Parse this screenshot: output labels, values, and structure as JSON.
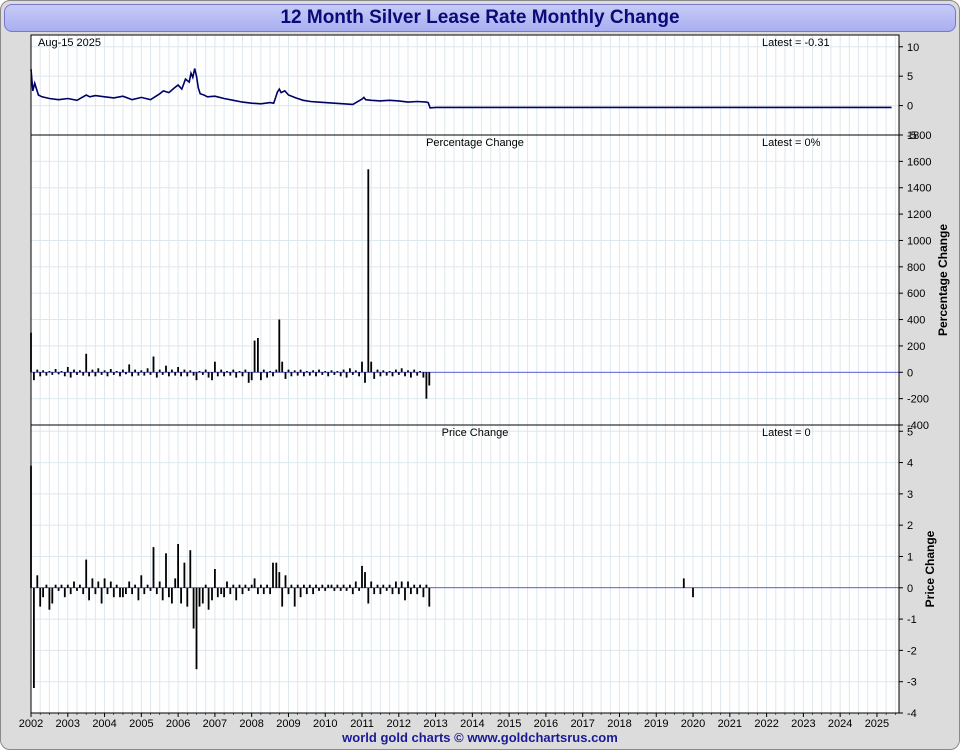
{
  "title": "12 Month Silver Lease Rate Monthly Change",
  "footer": "world gold charts © www.goldchartsrus.com",
  "colors": {
    "title_text": "#0a0a78",
    "title_bg": "#b8bcf4",
    "line": "#000066",
    "zero_line": "#3333cc",
    "bars": "#000000",
    "grid": "#dde8ee",
    "footer_text": "#1a1a99"
  },
  "x_axis": {
    "labels": [
      "2002",
      "2003",
      "2004",
      "2005",
      "2006",
      "2007",
      "2008",
      "2009",
      "2010",
      "2011",
      "2012",
      "2013",
      "2014",
      "2015",
      "2016",
      "2017",
      "2018",
      "2019",
      "2020",
      "2021",
      "2022",
      "2023",
      "2024",
      "2025"
    ],
    "range": [
      2002,
      2025.6
    ]
  },
  "chart_data": [
    {
      "type": "line",
      "name": "lease-rate",
      "date_label": "Aug-15  2025",
      "latest_label": "Latest = -0.31",
      "ylim": [
        -5,
        12
      ],
      "yticks": [
        "10",
        "5",
        "0",
        "-5"
      ],
      "ytick_values": [
        10,
        5,
        0,
        -5
      ],
      "x": [
        2002.0,
        2002.05,
        2002.1,
        2002.2,
        2002.3,
        2002.5,
        2002.75,
        2003.0,
        2003.25,
        2003.5,
        2003.6,
        2003.75,
        2004.0,
        2004.25,
        2004.5,
        2004.75,
        2005.0,
        2005.25,
        2005.5,
        2005.6,
        2005.75,
        2005.9,
        2006.0,
        2006.1,
        2006.2,
        2006.3,
        2006.35,
        2006.4,
        2006.45,
        2006.5,
        2006.55,
        2006.6,
        2006.7,
        2006.8,
        2007.0,
        2007.25,
        2007.5,
        2007.75,
        2008.0,
        2008.25,
        2008.5,
        2008.6,
        2008.7,
        2008.75,
        2008.8,
        2008.9,
        2009.0,
        2009.2,
        2009.4,
        2009.6,
        2009.8,
        2010.0,
        2010.25,
        2010.5,
        2010.75,
        2011.0,
        2011.05,
        2011.1,
        2011.25,
        2011.5,
        2011.75,
        2012.0,
        2012.25,
        2012.5,
        2012.75,
        2012.8,
        2012.85,
        2013.0,
        2014.0,
        2016.0,
        2018.0,
        2020.0,
        2022.0,
        2024.0,
        2025.4
      ],
      "y": [
        6.2,
        2.5,
        3.8,
        1.8,
        1.5,
        1.2,
        1.0,
        1.2,
        0.9,
        1.8,
        1.5,
        1.7,
        1.5,
        1.3,
        1.6,
        1.0,
        1.4,
        1.0,
        2.0,
        2.5,
        2.2,
        3.0,
        3.5,
        2.8,
        4.5,
        4.0,
        5.5,
        4.8,
        6.3,
        5.0,
        3.0,
        2.0,
        1.8,
        1.5,
        1.6,
        1.2,
        0.9,
        0.6,
        0.4,
        0.3,
        0.5,
        0.4,
        2.3,
        2.8,
        2.2,
        2.5,
        1.8,
        1.3,
        0.9,
        0.7,
        0.6,
        0.5,
        0.4,
        0.3,
        0.2,
        1.1,
        1.4,
        1.0,
        0.9,
        0.8,
        0.9,
        0.8,
        0.6,
        0.7,
        0.6,
        0.5,
        -0.4,
        -0.31,
        -0.31,
        -0.31,
        -0.31,
        -0.31,
        -0.31,
        -0.31,
        -0.31
      ]
    },
    {
      "type": "bar",
      "name": "percentage-change",
      "title": "Percentage Change",
      "latest_label": "Latest = 0%",
      "ylabel": "Percentage Change",
      "ylim": [
        -400,
        1800
      ],
      "yticks": [
        "1800",
        "1600",
        "1400",
        "1200",
        "1000",
        "800",
        "600",
        "400",
        "200",
        "0",
        "-200",
        "-400"
      ],
      "ytick_values": [
        1800,
        1600,
        1400,
        1200,
        1000,
        800,
        600,
        400,
        200,
        0,
        -200,
        -400
      ],
      "x": [
        2002.0,
        2002.08,
        2002.17,
        2002.25,
        2002.33,
        2002.42,
        2002.5,
        2002.58,
        2002.67,
        2002.75,
        2002.83,
        2002.92,
        2003.0,
        2003.08,
        2003.17,
        2003.25,
        2003.33,
        2003.42,
        2003.5,
        2003.58,
        2003.67,
        2003.75,
        2003.83,
        2003.92,
        2004.0,
        2004.08,
        2004.17,
        2004.25,
        2004.33,
        2004.42,
        2004.5,
        2004.58,
        2004.67,
        2004.75,
        2004.83,
        2004.92,
        2005.0,
        2005.08,
        2005.17,
        2005.25,
        2005.33,
        2005.42,
        2005.5,
        2005.58,
        2005.67,
        2005.75,
        2005.83,
        2005.92,
        2006.0,
        2006.08,
        2006.17,
        2006.25,
        2006.33,
        2006.42,
        2006.5,
        2006.58,
        2006.67,
        2006.75,
        2006.83,
        2006.92,
        2007.0,
        2007.08,
        2007.17,
        2007.25,
        2007.33,
        2007.42,
        2007.5,
        2007.58,
        2007.67,
        2007.75,
        2007.83,
        2007.92,
        2008.0,
        2008.08,
        2008.17,
        2008.25,
        2008.33,
        2008.42,
        2008.5,
        2008.58,
        2008.67,
        2008.75,
        2008.83,
        2008.92,
        2009.0,
        2009.08,
        2009.17,
        2009.25,
        2009.33,
        2009.42,
        2009.5,
        2009.58,
        2009.67,
        2009.75,
        2009.83,
        2009.92,
        2010.0,
        2010.08,
        2010.17,
        2010.25,
        2010.33,
        2010.42,
        2010.5,
        2010.58,
        2010.67,
        2010.75,
        2010.83,
        2010.92,
        2011.0,
        2011.08,
        2011.17,
        2011.25,
        2011.33,
        2011.42,
        2011.5,
        2011.58,
        2011.67,
        2011.75,
        2011.83,
        2011.92,
        2012.0,
        2012.08,
        2012.17,
        2012.25,
        2012.33,
        2012.42,
        2012.5,
        2012.58,
        2012.67,
        2012.75,
        2012.83,
        2019.75
      ],
      "values": [
        300,
        -60,
        20,
        -30,
        15,
        -25,
        10,
        -20,
        25,
        -15,
        10,
        -30,
        40,
        -40,
        20,
        -20,
        15,
        -25,
        140,
        -30,
        20,
        -30,
        30,
        -20,
        15,
        -30,
        25,
        -20,
        10,
        -30,
        20,
        -15,
        60,
        -30,
        20,
        -25,
        15,
        -25,
        30,
        -20,
        120,
        -40,
        20,
        -20,
        50,
        -30,
        20,
        -25,
        40,
        -30,
        20,
        -30,
        15,
        -25,
        -60,
        10,
        -20,
        20,
        -40,
        -60,
        80,
        -30,
        20,
        -30,
        10,
        -25,
        20,
        -40,
        10,
        -30,
        20,
        -80,
        -60,
        240,
        260,
        -60,
        20,
        -40,
        10,
        -30,
        20,
        400,
        80,
        -50,
        20,
        -30,
        15,
        -25,
        20,
        -30,
        10,
        -25,
        15,
        -30,
        20,
        -20,
        10,
        -30,
        15,
        -20,
        10,
        -30,
        20,
        -40,
        30,
        -20,
        15,
        -30,
        80,
        -80,
        1540,
        80,
        -50,
        20,
        -30,
        15,
        -25,
        10,
        -30,
        20,
        -20,
        30,
        -30,
        15,
        -40,
        20,
        -25,
        10,
        -40,
        -200,
        -100
      ]
    },
    {
      "type": "bar",
      "name": "price-change",
      "title": "Price Change",
      "latest_label": "Latest = 0",
      "ylabel": "Price Change",
      "ylim": [
        -4,
        5.2
      ],
      "yticks": [
        "5",
        "4",
        "3",
        "2",
        "1",
        "0",
        "-1",
        "-2",
        "-3",
        "-4"
      ],
      "ytick_values": [
        5,
        4,
        3,
        2,
        1,
        0,
        -1,
        -2,
        -3,
        -4
      ],
      "x": [
        2002.0,
        2002.08,
        2002.17,
        2002.25,
        2002.33,
        2002.42,
        2002.5,
        2002.58,
        2002.67,
        2002.75,
        2002.83,
        2002.92,
        2003.0,
        2003.08,
        2003.17,
        2003.25,
        2003.33,
        2003.42,
        2003.5,
        2003.58,
        2003.67,
        2003.75,
        2003.83,
        2003.92,
        2004.0,
        2004.08,
        2004.17,
        2004.25,
        2004.33,
        2004.42,
        2004.5,
        2004.58,
        2004.67,
        2004.75,
        2004.83,
        2004.92,
        2005.0,
        2005.08,
        2005.17,
        2005.25,
        2005.33,
        2005.42,
        2005.5,
        2005.58,
        2005.67,
        2005.75,
        2005.83,
        2005.92,
        2006.0,
        2006.08,
        2006.17,
        2006.25,
        2006.33,
        2006.42,
        2006.5,
        2006.58,
        2006.67,
        2006.75,
        2006.83,
        2006.92,
        2007.0,
        2007.08,
        2007.17,
        2007.25,
        2007.33,
        2007.42,
        2007.5,
        2007.58,
        2007.67,
        2007.75,
        2007.83,
        2007.92,
        2008.0,
        2008.08,
        2008.17,
        2008.25,
        2008.33,
        2008.42,
        2008.5,
        2008.58,
        2008.67,
        2008.75,
        2008.83,
        2008.92,
        2009.0,
        2009.08,
        2009.17,
        2009.25,
        2009.33,
        2009.42,
        2009.5,
        2009.58,
        2009.67,
        2009.75,
        2009.83,
        2009.92,
        2010.0,
        2010.08,
        2010.17,
        2010.25,
        2010.33,
        2010.42,
        2010.5,
        2010.58,
        2010.67,
        2010.75,
        2010.83,
        2010.92,
        2011.0,
        2011.08,
        2011.17,
        2011.25,
        2011.33,
        2011.42,
        2011.5,
        2011.58,
        2011.67,
        2011.75,
        2011.83,
        2011.92,
        2012.0,
        2012.08,
        2012.17,
        2012.25,
        2012.33,
        2012.42,
        2012.5,
        2012.58,
        2012.67,
        2012.75,
        2012.83,
        2019.75,
        2020.0
      ],
      "values": [
        3.9,
        -3.2,
        0.4,
        -0.6,
        -0.3,
        0.1,
        -0.7,
        -0.5,
        0.1,
        -0.1,
        0.1,
        -0.3,
        0.1,
        -0.2,
        0.2,
        -0.1,
        0.1,
        -0.2,
        0.9,
        -0.4,
        0.3,
        -0.2,
        0.2,
        -0.5,
        0.3,
        -0.2,
        0.2,
        -0.3,
        0.1,
        -0.3,
        -0.3,
        -0.2,
        0.2,
        -0.2,
        0.1,
        -0.4,
        0.4,
        -0.2,
        0.1,
        -0.1,
        1.3,
        -0.2,
        0.2,
        -0.4,
        1.1,
        -0.3,
        -0.5,
        0.3,
        1.4,
        -0.5,
        0.8,
        -0.6,
        1.2,
        -1.3,
        -2.6,
        -0.6,
        -0.5,
        0.1,
        -0.7,
        -0.4,
        0.6,
        -0.3,
        -0.2,
        -0.3,
        0.2,
        -0.2,
        0.1,
        -0.4,
        0.1,
        -0.2,
        0.1,
        -0.1,
        0.1,
        0.3,
        -0.2,
        0.1,
        -0.2,
        0.1,
        -0.2,
        0.8,
        0.8,
        0.5,
        -0.6,
        0.4,
        -0.2,
        0.1,
        -0.6,
        0.1,
        -0.3,
        0.1,
        -0.2,
        0.1,
        -0.2,
        0.1,
        -0.1,
        0.1,
        -0.1,
        0.1,
        0.1,
        -0.1,
        0.1,
        -0.1,
        0.1,
        -0.1,
        0.1,
        -0.2,
        0.2,
        -0.1,
        0.7,
        0.5,
        -0.5,
        0.2,
        -0.2,
        0.1,
        -0.2,
        0.1,
        -0.1,
        0.1,
        -0.2,
        0.2,
        -0.2,
        0.2,
        -0.4,
        0.2,
        -0.2,
        0.1,
        -0.2,
        0.1,
        -0.3,
        0.1,
        -0.6,
        0.3,
        -0.3
      ]
    }
  ]
}
